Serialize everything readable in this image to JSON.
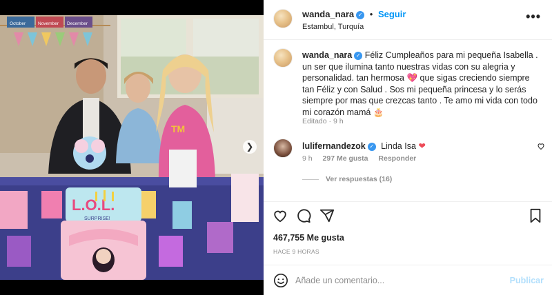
{
  "post": {
    "username": "wanda_nara",
    "follow_label": "Seguir",
    "separator": "•",
    "location": "Estambul, Turquía",
    "more_icon": "ellipsis-icon"
  },
  "photo": {
    "banner_months": [
      "October",
      "November",
      "December"
    ],
    "cake_text": "L.O.L.",
    "cake_subtext": "SURPRISE!"
  },
  "caption": {
    "username": "wanda_nara",
    "text": "Féliz Cumpleaños para mi pequeña Isabella . un ser que ilumina tanto nuestras vidas con su alegria y personalidad. tan hermosa 💖 que sigas creciendo siempre tan Féliz y con Salud . Sos mi pequeña princesa y lo serás siempre por mas que crezcas tanto . Te amo mi vida con todo mi corazón mamá 🎂",
    "meta": "Editado · 9 h"
  },
  "comment": {
    "username": "lulifernandezok",
    "text": "Linda Isa",
    "heart": "❤",
    "time": "9 h",
    "likes": "297 Me gusta",
    "reply_label": "Responder",
    "view_replies": "Ver respuestas (16)"
  },
  "actions": {
    "icons": [
      "heart-icon",
      "comment-icon",
      "share-icon",
      "bookmark-icon"
    ]
  },
  "stats": {
    "likes": "467,755 Me gusta",
    "time_ago": "HACE 9 HORAS"
  },
  "comment_box": {
    "placeholder": "Añade un comentario...",
    "publish_label": "Publicar"
  },
  "colors": {
    "accent": "#0095f6",
    "verified": "#3897f0",
    "heart": "#ed4956",
    "publish_disabled": "#b2dffc",
    "carousel_active_dot": "#3d9bff"
  },
  "carousel": {
    "slide_count": 6,
    "active_slide": 1
  }
}
